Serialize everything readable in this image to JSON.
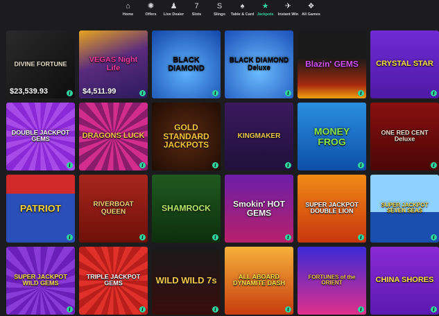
{
  "nav": [
    {
      "label": "Home",
      "icon": "home-icon",
      "glyph": "⌂",
      "active": false
    },
    {
      "label": "Offers",
      "icon": "offers-icon",
      "glyph": "✺",
      "active": false
    },
    {
      "label": "Live Dealer",
      "icon": "live-dealer-icon",
      "glyph": "♟",
      "active": false
    },
    {
      "label": "Slots",
      "icon": "slots-icon",
      "glyph": "7",
      "active": false
    },
    {
      "label": "Slingo",
      "icon": "slingo-icon",
      "glyph": "S",
      "active": false
    },
    {
      "label": "Table & Card",
      "icon": "table-card-icon",
      "glyph": "♠",
      "active": false
    },
    {
      "label": "Jackpots",
      "icon": "jackpots-icon",
      "glyph": "★",
      "active": true
    },
    {
      "label": "Instant Win",
      "icon": "instant-win-icon",
      "glyph": "✈",
      "active": false
    },
    {
      "label": "All Games",
      "icon": "all-games-icon",
      "glyph": "❖",
      "active": false
    }
  ],
  "games": [
    {
      "title": "DIVINE FORTUNE",
      "jackpot": "$23,539.93",
      "bg": "linear-gradient(135deg,#2a2a2a,#0e0e0e)",
      "color": "#e8e0c8",
      "size": 9
    },
    {
      "title": "VEGAS Night Life",
      "jackpot": "$4,511.99",
      "bg": "linear-gradient(160deg,#e7a41f 0%,#5a2b7e 45%,#2b1b5c 100%)",
      "color": "#ff3aa0",
      "size": 11
    },
    {
      "title": "BLACK DIAMOND",
      "jackpot": "",
      "bg": "radial-gradient(circle at 50% 60%,#5fb3ff,#1246a8)",
      "color": "#0b0b0b",
      "size": 11
    },
    {
      "title": "BLACK DIAMOND Deluxe",
      "jackpot": "",
      "bg": "radial-gradient(circle at 50% 60%,#6bbdff,#1a4fb8)",
      "color": "#0b0b0b",
      "size": 10
    },
    {
      "title": "Blazin' GEMS",
      "jackpot": "",
      "bg": "linear-gradient(180deg,#1a1a1a 40%,#a5290f 80%,#f0a010 100%)",
      "color": "#d14fff",
      "size": 12
    },
    {
      "title": "CRYSTAL STAR",
      "jackpot": "",
      "bg": "linear-gradient(180deg,#6f2bd4,#4e1aa6)",
      "color": "#ffe24a",
      "size": 11
    },
    {
      "title": "DOUBLE JACKPOT GEMS",
      "jackpot": "",
      "bg": "repeating-conic-gradient(from 0deg at 50% 50%,#8a2ad6 0 10deg,#a64ae8 10deg 20deg)",
      "color": "#ffffff",
      "size": 9
    },
    {
      "title": "DRAGONS LUCK",
      "jackpot": "",
      "bg": "repeating-conic-gradient(from 0deg at 50% 50%,#d22d8c 0 10deg,#8a1c6c 10deg 20deg)",
      "color": "#f7c84a",
      "size": 11
    },
    {
      "title": "GOLD STANDARD JACKPOTS",
      "jackpot": "",
      "bg": "radial-gradient(circle,#5a2a10,#200c04)",
      "color": "#f5c53a",
      "size": 12
    },
    {
      "title": "KINGMAKER",
      "jackpot": "",
      "bg": "linear-gradient(180deg,#3a1a5e,#20103a)",
      "color": "#f2c94c",
      "size": 10
    },
    {
      "title": "MONEY FROG",
      "jackpot": "",
      "bg": "linear-gradient(180deg,#2a8fe0,#0d4fa8)",
      "color": "#8be84a",
      "size": 14
    },
    {
      "title": "ONE RED CENT Deluxe",
      "jackpot": "",
      "bg": "linear-gradient(180deg,#8a1010,#4a0606)",
      "color": "#f0e0d0",
      "size": 9
    },
    {
      "title": "PATRIOT",
      "jackpot": "",
      "bg": "linear-gradient(180deg,#d22a2a 0 28%,#2b4fb8 28%)",
      "color": "#f7d23a",
      "size": 14
    },
    {
      "title": "RIVERBOAT QUEEN",
      "jackpot": "",
      "bg": "linear-gradient(180deg,#a8261c,#6e1008)",
      "color": "#f3d27a",
      "size": 10
    },
    {
      "title": "SHAMROCK",
      "jackpot": "",
      "bg": "linear-gradient(180deg,#1f5a1f,#0d2e0d)",
      "color": "#b9e86a",
      "size": 12
    },
    {
      "title": "Smokin' HOT GEMS",
      "jackpot": "",
      "bg": "linear-gradient(180deg,#6b1fa8,#b8206a)",
      "color": "#ffffff",
      "size": 12
    },
    {
      "title": "SUPER JACKPOT DOUBLE LION",
      "jackpot": "",
      "bg": "linear-gradient(180deg,#f08a14,#c8360e)",
      "color": "#ffffff",
      "size": 9
    },
    {
      "title": "SUPER JACKPOT SEVEN SEAS",
      "jackpot": "",
      "bg": "linear-gradient(180deg,#8fd1ff 0 55%,#1a4fb0 55%)",
      "color": "#ffe04a",
      "size": 8
    },
    {
      "title": "SUPER JACKPOT WILD GEMS",
      "jackpot": "",
      "bg": "repeating-conic-gradient(from 0deg at 50% 60%,#6b1fb8 0 10deg,#8a3ad6 10deg 20deg)",
      "color": "#ffe04a",
      "size": 9
    },
    {
      "title": "TRIPLE JACKPOT GEMS",
      "jackpot": "",
      "bg": "repeating-conic-gradient(from 0deg at 50% 50%,#e0302a 0 10deg,#b81e1a 10deg 20deg)",
      "color": "#ffffff",
      "size": 9
    },
    {
      "title": "WILD WILD 7s",
      "jackpot": "",
      "bg": "linear-gradient(180deg,#1a1a1a,#3a0d0d)",
      "color": "#f2c94c",
      "size": 13
    },
    {
      "title": "ALL ABOARD DYNAMITE DASH",
      "jackpot": "",
      "bg": "linear-gradient(180deg,#f5b13a,#c83c0e)",
      "color": "#ffe04a",
      "size": 9
    },
    {
      "title": "FORTUNES of the ORIENT",
      "jackpot": "",
      "bg": "linear-gradient(180deg,#3a2ad6,#e0308a)",
      "color": "#f2c94c",
      "size": 8
    },
    {
      "title": "CHINA SHORES",
      "jackpot": "",
      "bg": "linear-gradient(180deg,#8a2ad6,#5a1ab0)",
      "color": "#ffe04a",
      "size": 11
    }
  ],
  "info_glyph": "i"
}
